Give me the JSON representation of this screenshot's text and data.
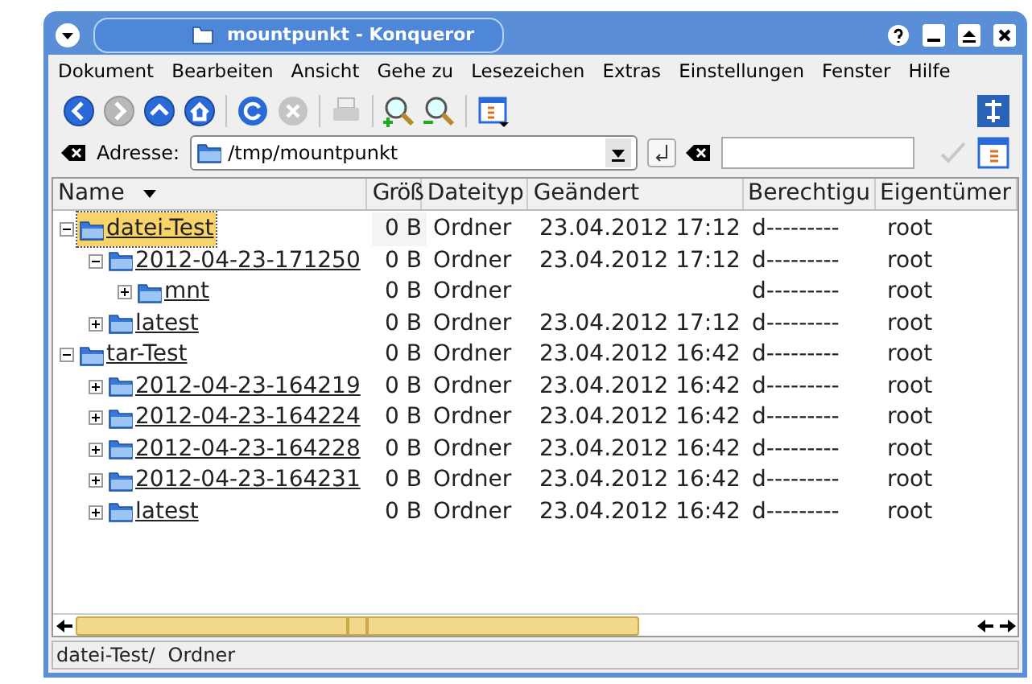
{
  "window": {
    "title": "mountpunkt - Konqueror"
  },
  "menu": [
    "Dokument",
    "Bearbeiten",
    "Ansicht",
    "Gehe zu",
    "Lesezeichen",
    "Extras",
    "Einstellungen",
    "Fenster",
    "Hilfe"
  ],
  "toolbar": [
    {
      "kind": "back",
      "disabled": false
    },
    {
      "kind": "forward",
      "disabled": true
    },
    {
      "kind": "up",
      "disabled": false
    },
    {
      "kind": "home",
      "disabled": false
    },
    {
      "kind": "reload",
      "disabled": false
    },
    {
      "kind": "stop",
      "disabled": true
    },
    {
      "kind": "print",
      "disabled": true
    },
    {
      "kind": "zoom-in",
      "disabled": false
    },
    {
      "kind": "zoom-out",
      "disabled": false
    },
    {
      "kind": "view",
      "disabled": false
    }
  ],
  "address": {
    "label": "Adresse:",
    "value": "/tmp/mountpunkt"
  },
  "columns": [
    "Name",
    "Größ",
    "Dateityp",
    "Geändert",
    "Berechtigu",
    "Eigentümer"
  ],
  "tree": [
    {
      "name": "datei-Test",
      "size": "0 B",
      "type": "Ordner",
      "modified": "23.04.2012 17:12",
      "permissions": "d---------",
      "owner": "root",
      "expanded": true,
      "selected": true,
      "children": [
        {
          "name": "2012-04-23-171250",
          "size": "0 B",
          "type": "Ordner",
          "modified": "23.04.2012 17:12",
          "permissions": "d---------",
          "owner": "root",
          "expanded": true,
          "selected": false,
          "children": [
            {
              "name": "mnt",
              "size": "0 B",
              "type": "Ordner",
              "permissions": "d---------",
              "owner": "root",
              "expanded": false,
              "selected": false
            }
          ]
        },
        {
          "name": "latest",
          "size": "0 B",
          "type": "Ordner",
          "modified": "23.04.2012 17:12",
          "permissions": "d---------",
          "owner": "root",
          "expanded": false,
          "selected": false
        }
      ]
    },
    {
      "name": "tar-Test",
      "size": "0 B",
      "type": "Ordner",
      "modified": "23.04.2012 16:42",
      "permissions": "d---------",
      "owner": "root",
      "expanded": true,
      "selected": false,
      "children": [
        {
          "name": "2012-04-23-164219",
          "size": "0 B",
          "type": "Ordner",
          "modified": "23.04.2012 16:42",
          "permissions": "d---------",
          "owner": "root",
          "expanded": false,
          "selected": false
        },
        {
          "name": "2012-04-23-164224",
          "size": "0 B",
          "type": "Ordner",
          "modified": "23.04.2012 16:42",
          "permissions": "d---------",
          "owner": "root",
          "expanded": false,
          "selected": false
        },
        {
          "name": "2012-04-23-164228",
          "size": "0 B",
          "type": "Ordner",
          "modified": "23.04.2012 16:42",
          "permissions": "d---------",
          "owner": "root",
          "expanded": false,
          "selected": false
        },
        {
          "name": "2012-04-23-164231",
          "size": "0 B",
          "type": "Ordner",
          "modified": "23.04.2012 16:42",
          "permissions": "d---------",
          "owner": "root",
          "expanded": false,
          "selected": false
        },
        {
          "name": "latest",
          "size": "0 B",
          "type": "Ordner",
          "modified": "23.04.2012 16:42",
          "permissions": "d---------",
          "owner": "root",
          "expanded": false,
          "selected": false
        }
      ]
    }
  ],
  "status_bar": {
    "path": "datei-Test/",
    "type": "Ordner"
  }
}
